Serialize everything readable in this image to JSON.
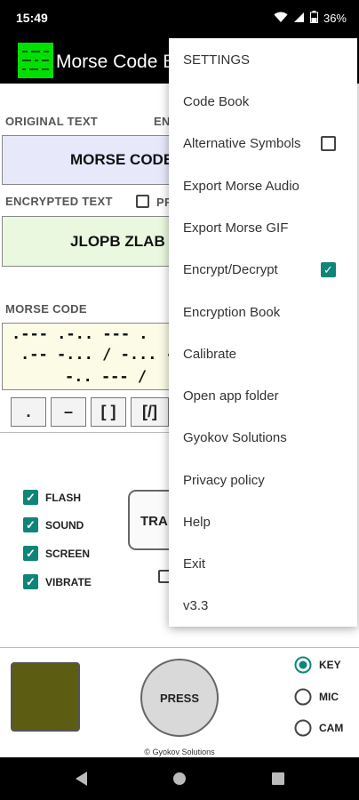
{
  "status_bar": {
    "time": "15:49",
    "battery": "36%"
  },
  "app": {
    "title": "Morse Code E"
  },
  "original_text": {
    "label": "ORIGINAL TEXT",
    "label_right": "EN",
    "value": "MORSE CODE"
  },
  "encrypted_text": {
    "label": "ENCRYPTED TEXT",
    "pr_label": "PR",
    "value": "JLOPB ZLAB"
  },
  "morse_code": {
    "label": "MORSE CODE",
    "line1": ".--- .-.. --- .",
    "line2": ".-- -... / -... --.",
    "line3": "-.. --- /"
  },
  "symbol_buttons": [
    ".",
    "–",
    "[ ]",
    "[/]"
  ],
  "options": [
    {
      "label": "FLASH",
      "checked": true
    },
    {
      "label": "SOUND",
      "checked": true
    },
    {
      "label": "SCREEN",
      "checked": true
    },
    {
      "label": "VIBRATE",
      "checked": true
    }
  ],
  "transmit": {
    "label": "TRA"
  },
  "press_button": {
    "label": "PRESS"
  },
  "input_modes": [
    {
      "label": "KEY",
      "selected": true
    },
    {
      "label": "MIC",
      "selected": false
    },
    {
      "label": "CAM",
      "selected": false
    }
  ],
  "footer": {
    "copyright": "© Gyokov Solutions"
  },
  "menu": {
    "items": [
      {
        "label": "SETTINGS"
      },
      {
        "label": "Code Book"
      },
      {
        "label": "Alternative Symbols",
        "checkbox": false
      },
      {
        "label": "Export Morse Audio"
      },
      {
        "label": "Export Morse GIF"
      },
      {
        "label": "Encrypt/Decrypt",
        "checkbox": true
      },
      {
        "label": "Encryption Book"
      },
      {
        "label": "Calibrate"
      },
      {
        "label": "Open app folder"
      },
      {
        "label": "Gyokov Solutions"
      },
      {
        "label": "Privacy policy"
      },
      {
        "label": "Help"
      },
      {
        "label": "Exit"
      },
      {
        "label": "v3.3"
      }
    ]
  },
  "colors": {
    "accent": "#0f8478",
    "logo_green": "#00e000",
    "indicator": "#5c5c12",
    "original_bg": "#e7e9fb",
    "encrypted_bg": "#eaf8e0",
    "morse_bg": "#fbfbe6"
  }
}
